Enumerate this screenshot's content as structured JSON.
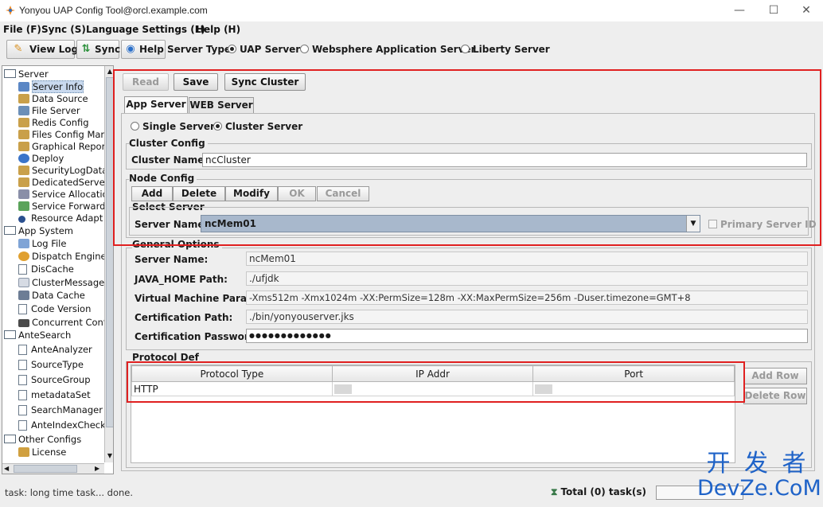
{
  "window": {
    "title": "Yonyou UAP Config Tool@orcl.example.com",
    "controls": [
      "—",
      "☐",
      "✕"
    ]
  },
  "menu": [
    "File (F)",
    "Sync (S)",
    "Language Settings (L)",
    "Help (H)"
  ],
  "toolbar": {
    "view_log": "View Log",
    "sync": "Sync",
    "help": "Help",
    "server_type_label": "Server Type:",
    "server_types": [
      {
        "label": "UAP Server",
        "selected": true
      },
      {
        "label": "Websphere Application Server",
        "selected": false
      },
      {
        "label": "Liberty Server",
        "selected": false
      }
    ]
  },
  "tree": {
    "server": "Server",
    "server_items": [
      "Server Info",
      "Data Source",
      "File Server",
      "Redis Config",
      "Files Config Man",
      "Graphical Repor",
      "Deploy",
      "SecurityLogData",
      "DedicatedServer",
      "Service Allocatio",
      "Service Forwardi",
      "Resource Adapt"
    ],
    "app_system": "App System",
    "app_items": [
      "Log File",
      "Dispatch Engine",
      "DisCache",
      "ClusterMessage",
      "Data Cache",
      "Code Version",
      "Concurrent Cont"
    ],
    "ante_search": "AnteSearch",
    "ante_items": [
      "AnteAnalyzer",
      "SourceType",
      "SourceGroup",
      "metadataSet",
      "SearchManager",
      "AnteIndexCheck"
    ],
    "other_configs": "Other Configs",
    "other_items": [
      "License"
    ]
  },
  "actions": {
    "read": "Read",
    "save": "Save",
    "sync_cluster": "Sync Cluster"
  },
  "tabs": [
    "App Server",
    "WEB Server"
  ],
  "mode": {
    "single": "Single Server",
    "cluster": "Cluster Server"
  },
  "cluster_config": {
    "title": "Cluster Config",
    "name_label": "Cluster Name:",
    "name_value": "ncCluster"
  },
  "node_config": {
    "title": "Node Config",
    "buttons": [
      "Add",
      "Delete",
      "Modify",
      "OK",
      "Cancel"
    ],
    "select_title": "Select Server",
    "server_name_label": "Server Name:",
    "server_name_value": "ncMem01",
    "primary_label": "Primary Server ID"
  },
  "general": {
    "title": "General Options",
    "fields": [
      {
        "label": "Server Name:",
        "value": "ncMem01"
      },
      {
        "label": "JAVA_HOME Path:",
        "value": "./ufjdk"
      },
      {
        "label": "Virtual Machine Param:",
        "value": "-Xms512m -Xmx1024m -XX:PermSize=128m -XX:MaxPermSize=256m -Duser.timezone=GMT+8"
      },
      {
        "label": "Certification Path:",
        "value": "./bin/yonyouserver.jks"
      },
      {
        "label": "Certification Password:",
        "value": "●●●●●●●●●●●●●"
      }
    ]
  },
  "protocol": {
    "title": "Protocol Def",
    "columns": [
      "Protocol Type",
      "IP Addr",
      "Port"
    ],
    "rows": [
      [
        "HTTP",
        "",
        ""
      ]
    ],
    "add_row": "Add Row",
    "delete_row": "Delete Row"
  },
  "status": {
    "task": "task: long time task... done.",
    "total": "Total (0) task(s)"
  },
  "watermark": {
    "line1": "开 发 者",
    "line2": "DevZe.CoM"
  }
}
